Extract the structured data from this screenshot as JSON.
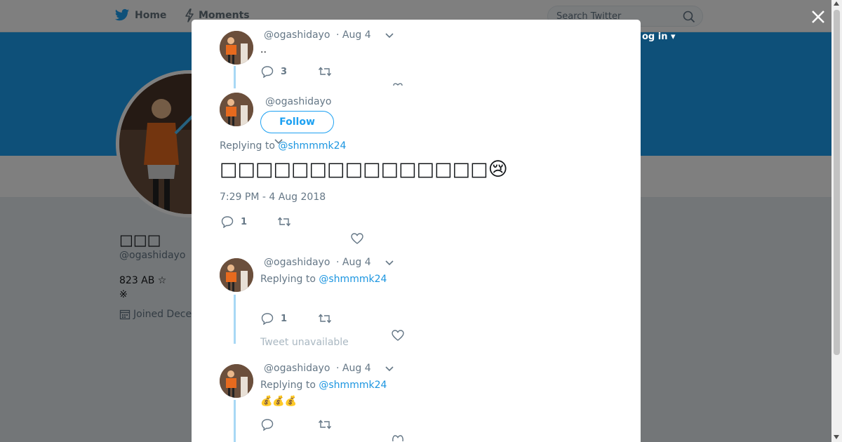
{
  "nav": {
    "home_label": "Home",
    "moments_label": "Moments",
    "search_placeholder": "Search Twitter",
    "login_label": "og in ▾"
  },
  "profile": {
    "name": "□□□",
    "handle": "@ogashidayo",
    "bio_line1": "823 AB ☆",
    "bio_line2": "※",
    "joined": "Joined Dece"
  },
  "modal": {
    "tweets": [
      {
        "handle": "@ogashidayo",
        "date": "· Aug 4",
        "text": "..",
        "reply_count": "3"
      },
      {
        "handle": "@ogashidayo",
        "follow_label": "Follow",
        "replying_prefix": "Replying to ",
        "replying_to": "@shmmmk24",
        "text": "□□□□□□□□□□□□□□□",
        "emoji": "😢",
        "timestamp": "7:29 PM - 4 Aug 2018",
        "reply_count": "1"
      },
      {
        "handle": "@ogashidayo",
        "date": "· Aug 4",
        "replying_prefix": "Replying to ",
        "replying_to": "@shmmmk24",
        "reply_count": "1",
        "unavailable": "Tweet unavailable"
      },
      {
        "handle": "@ogashidayo",
        "date": "· Aug 4",
        "replying_prefix": "Replying to ",
        "replying_to": "@shmmmk24",
        "text": "💰💰💰"
      }
    ]
  },
  "colors": {
    "brand": "#1da1f2",
    "link": "#1b95e0",
    "muted": "#657786",
    "thread_line": "#a8d8f5"
  }
}
